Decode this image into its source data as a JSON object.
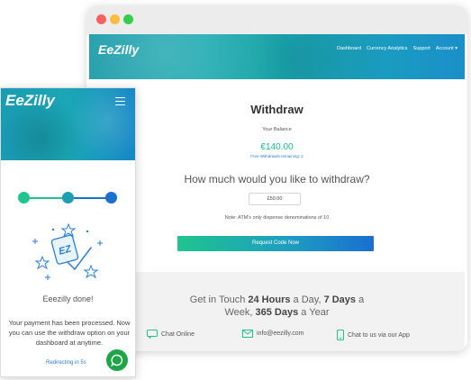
{
  "desktop": {
    "logo": "EeZilly",
    "nav": [
      "Dashboard",
      "Currency Analytics",
      "Support",
      "Account ▾"
    ],
    "title": "Withdraw",
    "balance_label": "Your Balance",
    "balance": "€140.00",
    "free_withdrawals": "Free Withdrawls remaining: 2",
    "question": "How much would you like to withdraw?",
    "amount_value": "£50.00",
    "note": "Note: ATM's only dispense denominations of 10",
    "request_button": "Request Code Now",
    "footer": {
      "touch_prefix": "Get in Touch ",
      "touch_hours": "24 Hours",
      "touch_mid": " a Day, ",
      "touch_days": "7 Days",
      "touch_suffix": " a",
      "touch_line2_prefix": "Week, ",
      "touch_year": "365 Days",
      "touch_line2_suffix": " a Year",
      "contacts": [
        {
          "icon": "chat-icon",
          "label": "Chat Online"
        },
        {
          "icon": "mail-icon",
          "label": "info@eezilly.com"
        },
        {
          "icon": "phone-icon",
          "label": "Chat to us via our App"
        }
      ]
    }
  },
  "mobile": {
    "logo": "EeZilly",
    "progress_steps": 3,
    "done_title": "Eeezilly done!",
    "message": "Your payment has been processed. Now you can use the withdraw option on your dashboard at anytime.",
    "redirect": "Redirecting in 5s"
  },
  "colors": {
    "accent_green": "#1fc48e",
    "accent_blue": "#1a6fd1",
    "header_teal": "#1aa7b6",
    "chat_green": "#1fa548"
  }
}
